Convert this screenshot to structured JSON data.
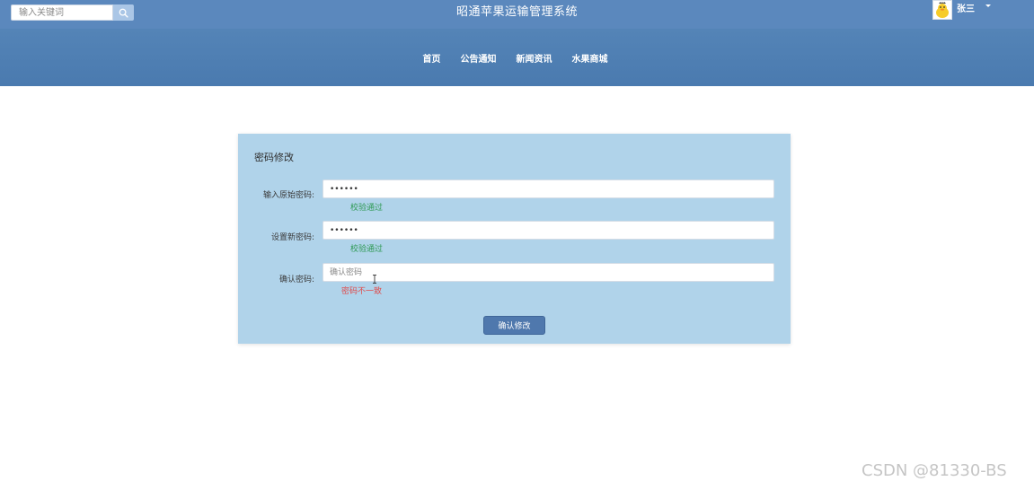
{
  "header": {
    "search_placeholder": "输入关键词",
    "title": "昭通苹果运输管理系统",
    "user_name": "张三"
  },
  "nav": {
    "items": [
      "首页",
      "公告通知",
      "新闻资讯",
      "水果商城"
    ]
  },
  "form": {
    "title": "密码修改",
    "old_password_label": "输入原始密码:",
    "old_password_value": "••••••",
    "old_password_hint": "校验通过",
    "new_password_label": "设置新密码:",
    "new_password_value": "••••••",
    "new_password_hint": "校验通过",
    "confirm_password_label": "确认密码:",
    "confirm_password_placeholder": "确认密码",
    "confirm_password_hint": "密码不一致",
    "submit_label": "确认修改"
  },
  "colors": {
    "topbar": "#5b88bd",
    "navbar": "#4d7db2",
    "card": "#b0d3ea",
    "button": "#4f78ad",
    "ok": "#2f9a55",
    "error": "#e04a4a"
  },
  "watermark": "CSDN @81330-BS"
}
